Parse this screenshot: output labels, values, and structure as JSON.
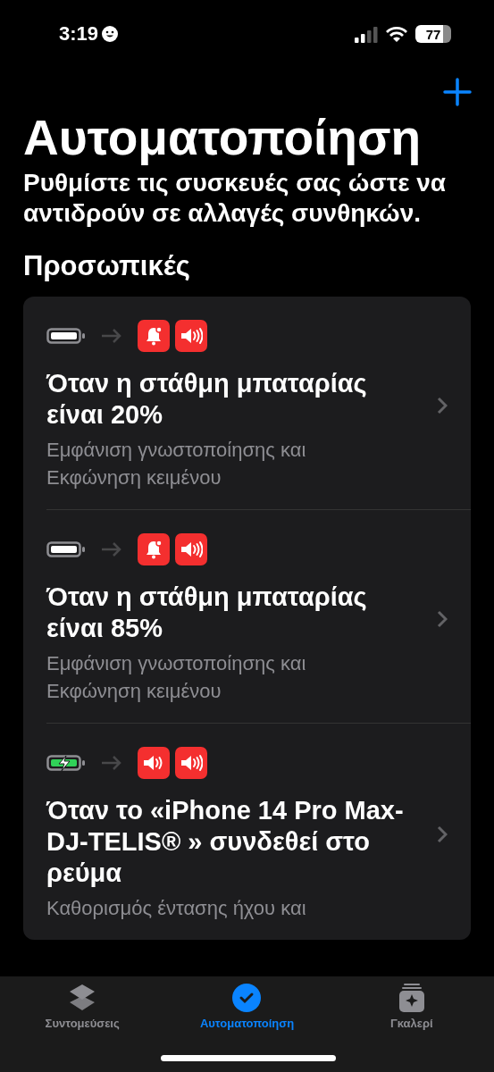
{
  "status_bar": {
    "time": "3:19",
    "battery": "77"
  },
  "title": "Αυτοματοποίηση",
  "subtitle": "Ρυθμίστε τις συσκευές σας ώστε να αντιδρούν σε αλλαγές συνθηκών.",
  "section": "Προσωπικές",
  "automations": [
    {
      "trigger": {
        "kind": "battery"
      },
      "actions": [
        {
          "kind": "notification"
        },
        {
          "kind": "speak"
        }
      ],
      "title": "Όταν η στάθμη μπαταρίας είναι 20%",
      "description": "Εμφάνιση γνωστοποίησης και Εκφώνηση κειμένου"
    },
    {
      "trigger": {
        "kind": "battery"
      },
      "actions": [
        {
          "kind": "notification"
        },
        {
          "kind": "speak"
        }
      ],
      "title": "Όταν η στάθμη μπαταρίας είναι 85%",
      "description": "Εμφάνιση γνωστοποίησης και Εκφώνηση κειμένου"
    },
    {
      "trigger": {
        "kind": "charging"
      },
      "actions": [
        {
          "kind": "volume"
        },
        {
          "kind": "speak"
        }
      ],
      "title": "Όταν το «iPhone 14 Pro Max-DJ-TELIS® » συνδεθεί στο ρεύμα",
      "description": "Καθορισμός έντασης ήχου και"
    }
  ],
  "tabs": [
    {
      "kind": "shortcuts",
      "label": "Συντομεύσεις",
      "selected": false
    },
    {
      "kind": "automation",
      "label": "Αυτοματοποίηση",
      "selected": true
    },
    {
      "kind": "gallery",
      "label": "Γκαλερί",
      "selected": false
    }
  ]
}
